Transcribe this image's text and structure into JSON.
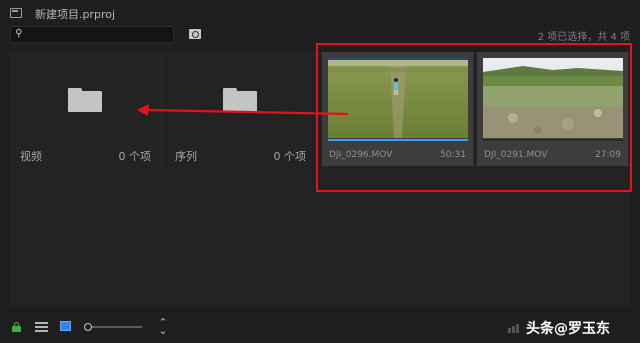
{
  "header": {
    "project_title": "新建项目.prproj",
    "project_icon": "project-file-icon"
  },
  "search": {
    "value": "",
    "placeholder": "",
    "icon": "search-icon"
  },
  "toolbar": {
    "new_bin_icon": "find-in-bin-icon"
  },
  "status": {
    "selection_text": "2 项已选择，共 4 项"
  },
  "bins": [
    {
      "name": "视频",
      "count": "0 个项",
      "icon": "folder-icon"
    },
    {
      "name": "序列",
      "count": "0 个项",
      "icon": "folder-icon"
    }
  ],
  "clips": [
    {
      "name": "DJI_0296.MOV",
      "duration": "50:31",
      "progress": 1.0,
      "scene": "field-with-child"
    },
    {
      "name": "DJI_0291.MOV",
      "duration": "27:09",
      "progress": 0,
      "scene": "riverbank"
    }
  ],
  "annotation": {
    "highlight_color": "#e0141e",
    "arrow_color": "#e0141e"
  },
  "footer": {
    "lock_state": "unlocked",
    "list_view_icon": "list-view-icon",
    "icon_view_icon": "icon-view-icon",
    "zoom_level": 0.0,
    "sort_icon": "sort-icon",
    "watermark": "头条@罗玉东"
  },
  "colors": {
    "accent": "#2f86e6",
    "lock": "#3cb53c"
  }
}
